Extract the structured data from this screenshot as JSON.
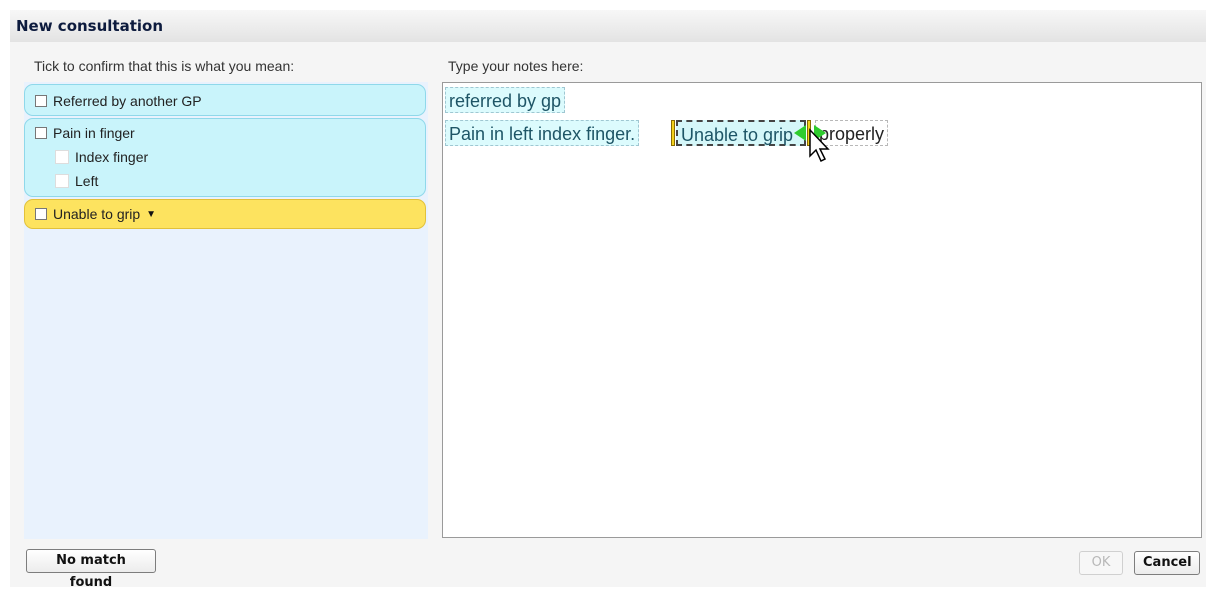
{
  "title": "New consultation",
  "left_prompt": "Tick to confirm that this is what you mean:",
  "right_prompt": "Type your notes here:",
  "concepts": [
    {
      "label": "Referred by another GP"
    },
    {
      "label": "Pain in finger",
      "children": [
        {
          "label": "Index finger"
        },
        {
          "label": "Left"
        }
      ]
    },
    {
      "label": "Unable to grip",
      "arrow": "▼"
    }
  ],
  "notes": {
    "line1": "referred by gp",
    "line2_part1": "Pain in left index finger.",
    "line2_selected": "Unable to grip",
    "line2_tail": "properly"
  },
  "buttons": {
    "no_match": "No match found",
    "ok": "OK",
    "cancel": "Cancel"
  },
  "colors": {
    "concept_bg": "#c9f4fb",
    "concept_highlight": "#fde35f",
    "handle_green": "#2ecc2e"
  }
}
